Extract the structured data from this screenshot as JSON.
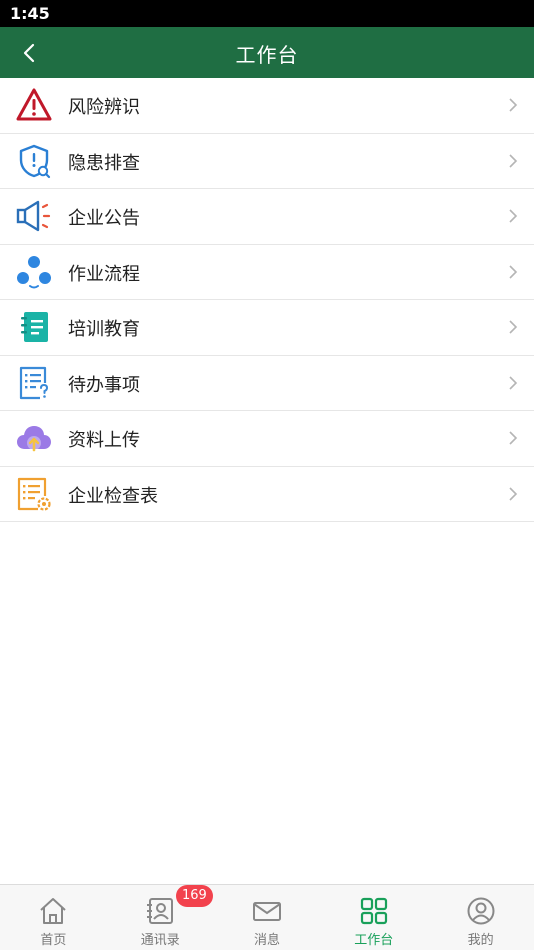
{
  "status_bar": {
    "time": "1:45"
  },
  "nav": {
    "title": "工作台",
    "back_icon": "chevron-left-icon"
  },
  "menu": [
    {
      "label": "风险辨识",
      "icon": "warning-triangle-icon",
      "color": "#c0182a"
    },
    {
      "label": "隐患排查",
      "icon": "shield-search-icon",
      "color": "#2a7fd4"
    },
    {
      "label": "企业公告",
      "icon": "megaphone-icon",
      "color": "#2a6fb8"
    },
    {
      "label": "作业流程",
      "icon": "workflow-icon",
      "color": "#2e86e0"
    },
    {
      "label": "培训教育",
      "icon": "notebook-icon",
      "color": "#1ab3a6"
    },
    {
      "label": "待办事项",
      "icon": "todo-list-icon",
      "color": "#3a8ad8"
    },
    {
      "label": "资料上传",
      "icon": "cloud-upload-icon",
      "color": "#9b7ae6"
    },
    {
      "label": "企业检查表",
      "icon": "checklist-gear-icon",
      "color": "#f0a030"
    }
  ],
  "tabs": [
    {
      "label": "首页",
      "icon": "home-icon",
      "active": false
    },
    {
      "label": "通讯录",
      "icon": "contacts-icon",
      "active": false
    },
    {
      "label": "消息",
      "icon": "mail-icon",
      "active": false
    },
    {
      "label": "工作台",
      "icon": "grid-icon",
      "active": true
    },
    {
      "label": "我的",
      "icon": "user-icon",
      "active": false
    }
  ],
  "message_badge": "169",
  "colors": {
    "nav_bg": "#1f6e43",
    "tab_active": "#19a05a",
    "badge": "#f2424d"
  }
}
